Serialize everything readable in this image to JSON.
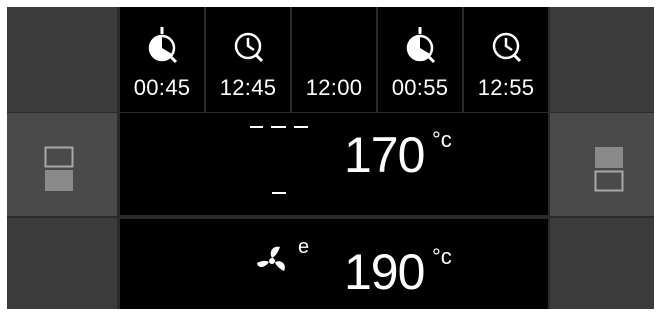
{
  "timers": [
    {
      "label": "00:45",
      "icon": "clock-partial-icon"
    },
    {
      "label": "12:45",
      "icon": "clock-icon"
    },
    {
      "label": "12:00",
      "icon": ""
    },
    {
      "label": "00:55",
      "icon": "clock-partial-icon"
    },
    {
      "label": "12:55",
      "icon": "clock-icon"
    }
  ],
  "upper_zone": {
    "temperature": "170",
    "unit": "°c",
    "mode_icon": "top-bottom-heat-icon"
  },
  "lower_zone": {
    "temperature": "190",
    "unit": "°c",
    "mode_icon": "fan-eco-icon",
    "mode_superscript": "e"
  },
  "side_buttons": {
    "left_icon": "select-lower-compartment-icon",
    "right_icon": "select-upper-compartment-icon"
  },
  "colors": {
    "background": "#2a2a2a",
    "panel_gray": "#3b3b3b",
    "display": "#000000",
    "text": "#ffffff",
    "toggle_fill": "#8a8a8a"
  }
}
